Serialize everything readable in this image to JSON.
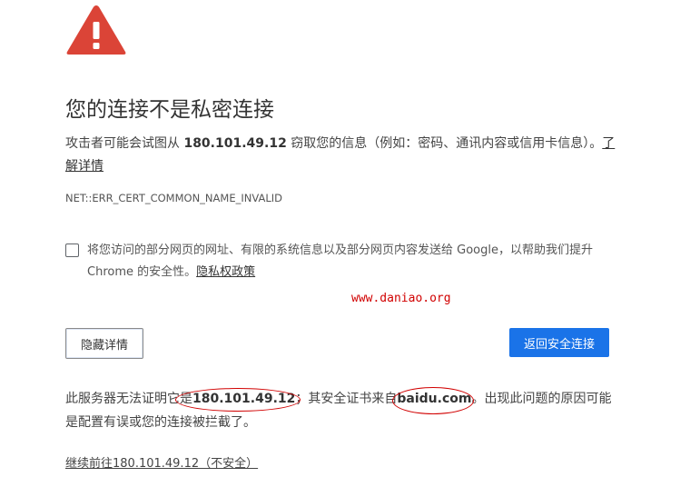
{
  "title": "您的连接不是私密连接",
  "description": {
    "before": "攻击者可能会试图从 ",
    "host": "180.101.49.12",
    "after": " 窃取您的信息（例如：密码、通讯内容或信用卡信息）。",
    "learn_more": "了解详情"
  },
  "error_code": "NET::ERR_CERT_COMMON_NAME_INVALID",
  "optin": {
    "text": "将您访问的部分网页的网址、有限的系统信息以及部分网页内容发送给 Google，以帮助我们提升 Chrome 的安全性。",
    "privacy_link": "隐私权政策"
  },
  "watermark": "www.daniao.org",
  "buttons": {
    "details": "隐藏详情",
    "back": "返回安全连接"
  },
  "details": {
    "part1": "此服务器无法证明它是",
    "host": "180.101.49.12",
    "part2": "；其安全证书来自",
    "cert_domain": "baidu.com",
    "part3": "。出现此问题的原因可能是配置有误或您的连接被拦截了。"
  },
  "proceed_link": "继续前往180.101.49.12（不安全）",
  "colors": {
    "warning_red": "#db4437",
    "primary_blue": "#1a73e8",
    "annotation_red": "#d10000"
  }
}
